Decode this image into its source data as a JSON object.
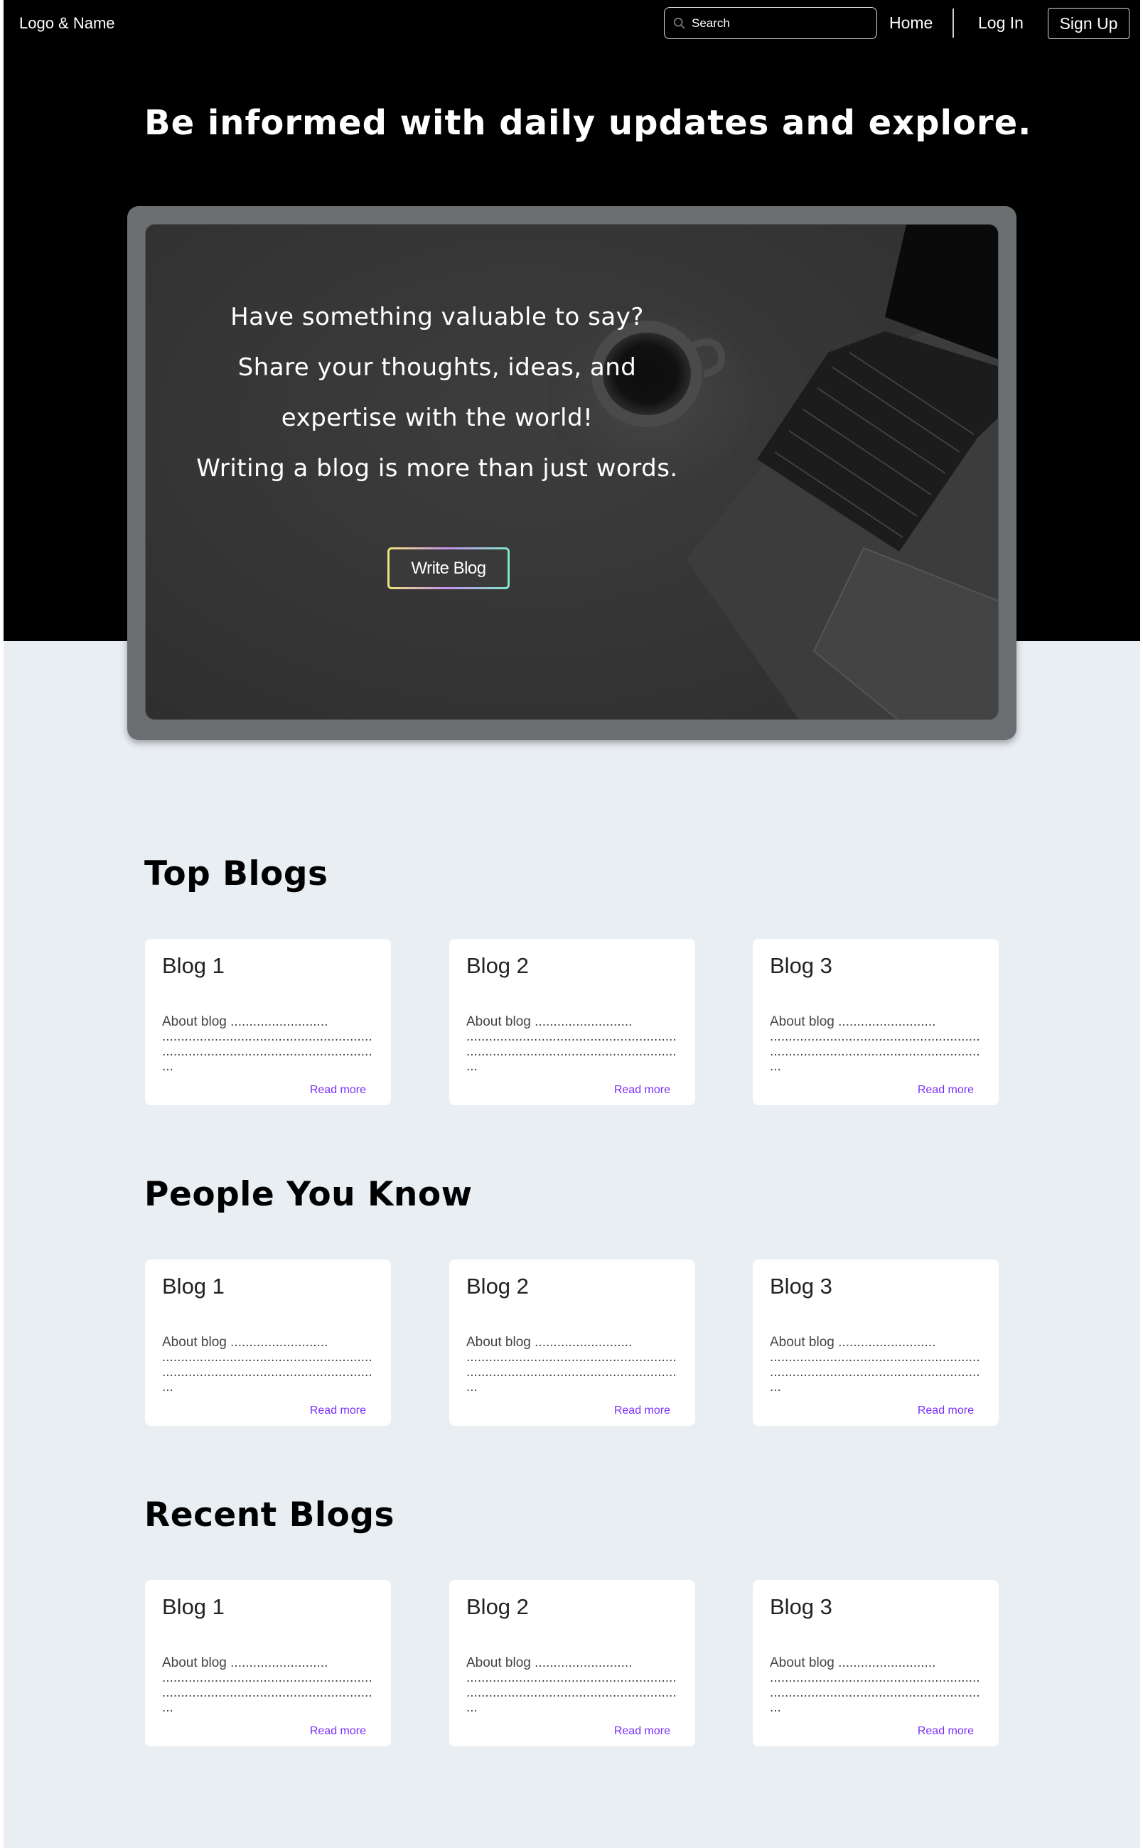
{
  "nav": {
    "brand": "Logo & Name",
    "search_placeholder": "Search",
    "home": "Home",
    "login": "Log In",
    "signup": "Sign Up"
  },
  "hero": {
    "headline": "Be informed with daily updates and explore.",
    "promo_lines": [
      "Have something valuable to say?",
      "Share your thoughts, ideas, and",
      "expertise with the world!",
      "Writing a blog is more than just words."
    ],
    "write_button": "Write Blog"
  },
  "sections": [
    {
      "title": "Top Blogs",
      "cards": [
        {
          "title": "Blog 1",
          "about": "About blog ..........................\n........................................................\n........................................................\n...",
          "read_more": "Read more"
        },
        {
          "title": "Blog 2",
          "about": "About blog ..........................\n........................................................\n........................................................\n...",
          "read_more": "Read more"
        },
        {
          "title": "Blog 3",
          "about": "About blog ..........................\n........................................................\n........................................................\n...",
          "read_more": "Read more"
        }
      ]
    },
    {
      "title": "People You Know",
      "cards": [
        {
          "title": "Blog 1",
          "about": "About blog ..........................\n........................................................\n........................................................\n...",
          "read_more": "Read more"
        },
        {
          "title": "Blog 2",
          "about": "About blog ..........................\n........................................................\n........................................................\n...",
          "read_more": "Read more"
        },
        {
          "title": "Blog 3",
          "about": "About blog ..........................\n........................................................\n........................................................\n...",
          "read_more": "Read more"
        }
      ]
    },
    {
      "title": "Recent Blogs",
      "cards": [
        {
          "title": "Blog 1",
          "about": "About blog ..........................\n........................................................\n........................................................\n...",
          "read_more": "Read more"
        },
        {
          "title": "Blog 2",
          "about": "About blog ..........................\n........................................................\n........................................................\n...",
          "read_more": "Read more"
        },
        {
          "title": "Blog 3",
          "about": "About blog ..........................\n........................................................\n........................................................\n...",
          "read_more": "Read more"
        }
      ]
    }
  ],
  "colors": {
    "hero_background": "#000000",
    "page_background": "#e9eef3",
    "read_more_link": "#7b2ff7",
    "promo_card": "#343434"
  }
}
